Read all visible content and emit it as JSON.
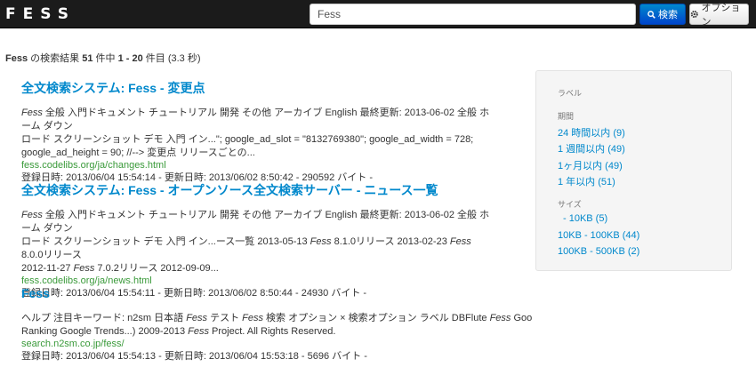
{
  "navbar": {
    "brand": "FESS",
    "search_value": "Fess",
    "search_button_label": "検索",
    "options_button_label": "オプション"
  },
  "summary": {
    "query": "Fess",
    "text1": " の検索結果 ",
    "total": "51",
    "text2": " 件中 ",
    "range": "1 - 20",
    "text3": " 件目 (3.3 秒)"
  },
  "results": [
    {
      "title": "全文検索システム: Fess - 変更点",
      "body_em1": "Fess",
      "body_line1": " 全般 入門ドキュメント チュートリアル 開発 その他 アーカイブ English 最終更新: 2013-06-02 全般 ホーム ダウン",
      "body_line2": "ロード スクリーンショット デモ 入門 イン...\"; google_ad_slot = \"8132769380\"; google_ad_width = 728;",
      "body_line3": "google_ad_height = 90; //--> 変更点 リリースごとの...",
      "url": "fess.codelibs.org/ja/changes.html",
      "meta": "登録日時: 2013/06/04 15:54:14 - 更新日時: 2013/06/02 8:50:42 - 290592 バイト -"
    },
    {
      "title": "全文検索システム: Fess - オープンソース全文検索サーバー - ニュース一覧",
      "body_em1": "Fess",
      "body_line1": " 全般 入門ドキュメント チュートリアル 開発 その他 アーカイブ English 最終更新: 2013-06-02 全般 ホーム ダウン",
      "body_line2a": "ロード スクリーンショット デモ 入門 イン...ース一覧 2013-05-13 ",
      "body_em2": "Fess",
      "body_line2b": " 8.1.0リリース 2013-02-23 ",
      "body_em3": "Fess",
      "body_line2c": " 8.0.0リリース",
      "body_line3a": "2012-11-27 ",
      "body_em4": "Fess",
      "body_line3b": " 7.0.2リリース 2012-09-09...",
      "url": "fess.codelibs.org/ja/news.html",
      "meta": "登録日時: 2013/06/04 15:54:11 - 更新日時: 2013/06/02 8:50:44 - 24930 バイト -"
    },
    {
      "title": "Fess",
      "body_line1a": "ヘルプ 注目キーワード: n2sm 日本語 ",
      "body_em1": "Fess",
      "body_line1b": " テスト ",
      "body_em2": "Fess",
      "body_line1c": " 検索 オプション × 検索オプション ラベル DBFlute ",
      "body_em3": "Fess",
      "body_line1d": " Goo",
      "body_line2a": "Ranking Google Trends...) 2009-2013 ",
      "body_em4": "Fess",
      "body_line2b": " Project. All Rights Reserved.",
      "url": "search.n2sm.co.jp/fess/",
      "meta": "登録日時: 2013/06/04 15:54:13 - 更新日時: 2013/06/04 15:53:18 - 5696 バイト -"
    }
  ],
  "sidebar": {
    "label_header": "ラベル",
    "period_header": "期間",
    "period_items": [
      "24 時間以内 (9)",
      "1 週間以内 (49)",
      "1ヶ月以内 (49)",
      "1 年以内 (51)"
    ],
    "size_header": "サイズ",
    "size_items": [
      "- 10KB (5)",
      "10KB - 100KB (44)",
      "100KB - 500KB (2)"
    ]
  }
}
